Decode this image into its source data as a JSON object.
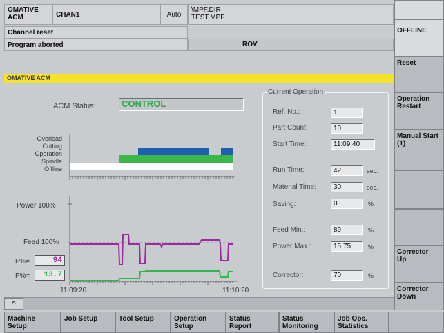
{
  "header": {
    "program_title": "OMATIVE\nACM",
    "channel": "CHAN1",
    "mode": "Auto",
    "path": "\\MPF.DIR\nTEST.MPF",
    "message1": "Channel reset",
    "message2": "Program aborted",
    "status_rov": "ROV"
  },
  "panel": {
    "title": "OMATIVE ACM",
    "acm_status_label": "ACM Status:",
    "acm_status_value": "CONTROL",
    "current_operation_title": "Current Operation",
    "fields": {
      "ref_no": {
        "label": "Ref. No.:",
        "value": "1"
      },
      "part_count": {
        "label": "Part Count:",
        "value": "10"
      },
      "start_time": {
        "label": "Start Time:",
        "value": "11:09:40"
      },
      "run_time": {
        "label": "Run Time:",
        "value": "42",
        "unit": "sec."
      },
      "material_time": {
        "label": "Material Time:",
        "value": "30",
        "unit": "sec."
      },
      "saving": {
        "label": "Saving:",
        "value": "0",
        "unit": "%"
      },
      "feed_min": {
        "label": "Feed Min.:",
        "value": "89",
        "unit": "%"
      },
      "power_max": {
        "label": "Power Max.:",
        "value": "15.75",
        "unit": "%"
      },
      "corrector": {
        "label": "Corrector:",
        "value": "70",
        "unit": "%"
      }
    }
  },
  "state_chart": {
    "labels": [
      "Overload",
      "Cutting",
      "Operation",
      "Spindle",
      "Offline"
    ],
    "colors": {
      "cutting": "#1f5fb0",
      "operation": "#3cb64a",
      "spindle": "#ffffff"
    }
  },
  "trend_chart": {
    "power_label": "Power 100%",
    "feed_label": "Feed 100%",
    "f_label": "F%=",
    "f_value": "94",
    "p_label": "P%=",
    "p_value": "13.7",
    "time_start": "11:09:20",
    "time_end": "11:10:20",
    "feed_color": "#9b2a9b",
    "power_color": "#2db84a"
  },
  "softkeys_vertical": [
    {
      "label": "",
      "light": true
    },
    {
      "label": "OFFLINE",
      "light": true
    },
    {
      "label": "Reset",
      "light": false
    },
    {
      "label": "Operation\nRestart",
      "light": false
    },
    {
      "label": "Manual Start\n(1)",
      "light": false
    },
    {
      "label": "",
      "light": false
    },
    {
      "label": "",
      "light": false
    },
    {
      "label": "Corrector\nUp",
      "light": false
    },
    {
      "label": "Corrector\nDown",
      "light": false
    }
  ],
  "softkeys_horizontal": [
    {
      "label": "Machine\nSetup"
    },
    {
      "label": "Job Setup"
    },
    {
      "label": "Tool Setup"
    },
    {
      "label": "Operation\nSetup"
    },
    {
      "label": "Status\nReport"
    },
    {
      "label": "Status\nMonitoring"
    },
    {
      "label": "Job Ops.\nStatistics"
    },
    {
      "label": ""
    }
  ],
  "recall_key": "^"
}
